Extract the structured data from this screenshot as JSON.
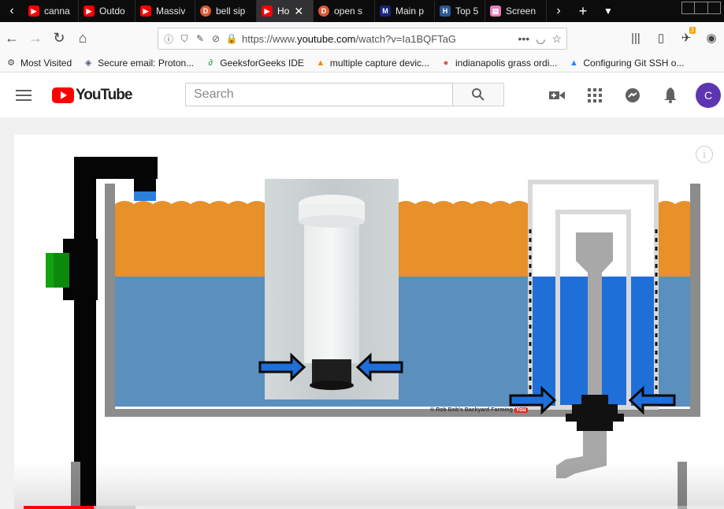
{
  "browser": {
    "tabs": [
      {
        "title": "canna",
        "favicon": "youtube-icon",
        "color": "#ff0000"
      },
      {
        "title": "Outdo",
        "favicon": "youtube-icon",
        "color": "#ff0000"
      },
      {
        "title": "Massiv",
        "favicon": "youtube-icon",
        "color": "#ff0000"
      },
      {
        "title": "bell sip",
        "favicon": "duckduckgo-icon",
        "color": "#de5833"
      },
      {
        "title": "Ho",
        "favicon": "youtube-icon",
        "color": "#ff0000",
        "active": true
      },
      {
        "title": "open s",
        "favicon": "duckduckgo-icon",
        "color": "#de5833"
      },
      {
        "title": "Main p",
        "favicon": "m-icon",
        "color": "#1a237e"
      },
      {
        "title": "Top 5",
        "favicon": "h-icon",
        "color": "#2b5797"
      },
      {
        "title": "Screen",
        "favicon": "screenshot-icon",
        "color": "#e87bb8"
      }
    ],
    "url_prefix": "https://www.",
    "url_domain": "youtube.com",
    "url_rest": "/watch?v=Ia1BQFTaG",
    "extension_badge": "3",
    "bookmarks": [
      {
        "label": "Most Visited",
        "icon": "gear-icon"
      },
      {
        "label": "Secure email: Proton...",
        "icon": "protonmail-icon"
      },
      {
        "label": "GeeksforGeeks IDE",
        "icon": "gfg-icon"
      },
      {
        "label": "multiple capture devic...",
        "icon": "vlc-icon"
      },
      {
        "label": "indianapolis grass ordi...",
        "icon": "duckduckgo-icon"
      },
      {
        "label": "Configuring Git SSH o...",
        "icon": "atlassian-icon"
      }
    ]
  },
  "youtube": {
    "logo_text": "YouTube",
    "search_placeholder": "Search",
    "avatar_initial": "C"
  },
  "video": {
    "watermark": "© Rob Bob's Backyard Farming",
    "watermark_badge": "You",
    "played_fraction": 0.1,
    "buffered_fraction": 0.16
  }
}
